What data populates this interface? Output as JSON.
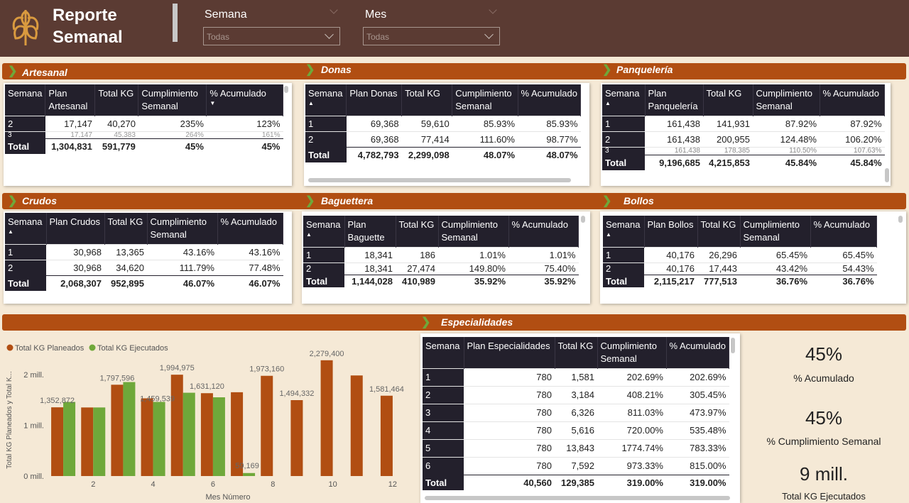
{
  "header": {
    "title_line1": "Reporte",
    "title_line2": "Semanal",
    "slicers": [
      {
        "label": "Semana",
        "value": "Todas"
      },
      {
        "label": "Mes",
        "value": "Todas"
      }
    ]
  },
  "colors": {
    "header_bg": "#5b3b33",
    "section_bar": "#b14e12",
    "table_header": "#23202c",
    "planned": "#b14e12",
    "executed": "#6fa83a",
    "page_bg": "#f5e9d6"
  },
  "sections": {
    "artesanal": {
      "title": "Artesanal",
      "headers": [
        "Semana",
        "Plan Artesanal",
        "Total KG",
        "Cumplimiento Semanal",
        "% Acumulado"
      ],
      "rows": [
        [
          "2",
          "17,147",
          "40,270",
          "235%",
          "123%"
        ],
        [
          "3",
          "17,147",
          "45,383",
          "264%",
          "161%"
        ]
      ],
      "total": [
        "Total",
        "1,304,831",
        "591,779",
        "45%",
        "45%"
      ]
    },
    "donas": {
      "title": "Donas",
      "headers": [
        "Semana",
        "Plan Donas",
        "Total KG",
        "Cumplimiento Semanal",
        "% Acumulado"
      ],
      "rows": [
        [
          "1",
          "69,368",
          "59,610",
          "85.93%",
          "85.93%"
        ],
        [
          "2",
          "69,368",
          "77,414",
          "111.60%",
          "98.77%"
        ]
      ],
      "total": [
        "Total",
        "4,782,793",
        "2,299,098",
        "48.07%",
        "48.07%"
      ]
    },
    "panqueleria": {
      "title": "Panquelería",
      "headers": [
        "Semana",
        "Plan Panquelería",
        "Total KG",
        "Cumplimiento Semanal",
        "% Acumulado"
      ],
      "rows": [
        [
          "1",
          "161,438",
          "141,931",
          "87.92%",
          "87.92%"
        ],
        [
          "2",
          "161,438",
          "200,955",
          "124.48%",
          "106.20%"
        ],
        [
          "3",
          "161,438",
          "178,385",
          "110.50%",
          "107.63%"
        ]
      ],
      "total": [
        "Total",
        "9,196,685",
        "4,215,853",
        "45.84%",
        "45.84%"
      ]
    },
    "crudos": {
      "title": "Crudos",
      "headers": [
        "Semana",
        "Plan Crudos",
        "Total KG",
        "Cumplimiento Semanal",
        "% Acumulado"
      ],
      "rows": [
        [
          "1",
          "30,968",
          "13,365",
          "43.16%",
          "43.16%"
        ],
        [
          "2",
          "30,968",
          "34,620",
          "111.79%",
          "77.48%"
        ]
      ],
      "total": [
        "Total",
        "2,068,307",
        "952,895",
        "46.07%",
        "46.07%"
      ]
    },
    "baguettera": {
      "title": "Baguettera",
      "headers": [
        "Semana",
        "Plan Baguette",
        "Total KG",
        "Cumplimiento Semanal",
        "% Acumulado"
      ],
      "rows": [
        [
          "1",
          "18,341",
          "186",
          "1.01%",
          "1.01%"
        ],
        [
          "2",
          "18,341",
          "27,474",
          "149.80%",
          "75.40%"
        ]
      ],
      "total": [
        "Total",
        "1,144,028",
        "410,989",
        "35.92%",
        "35.92%"
      ]
    },
    "bollos": {
      "title": "Bollos",
      "headers": [
        "Semana",
        "Plan Bollos",
        "Total KG",
        "Cumplimiento Semanal",
        "% Acumulado"
      ],
      "rows": [
        [
          "1",
          "40,176",
          "26,296",
          "65.45%",
          "65.45%"
        ],
        [
          "2",
          "40,176",
          "17,443",
          "43.42%",
          "54.43%"
        ]
      ],
      "total": [
        "Total",
        "2,115,217",
        "777,513",
        "36.76%",
        "36.76%"
      ]
    },
    "especialidades": {
      "title": "Especialidades",
      "headers": [
        "Semana",
        "Plan Especialidades",
        "Total KG",
        "Cumplimiento Semanal",
        "% Acumulado"
      ],
      "rows": [
        [
          "1",
          "780",
          "1,581",
          "202.69%",
          "202.69%"
        ],
        [
          "2",
          "780",
          "3,184",
          "408.21%",
          "305.45%"
        ],
        [
          "3",
          "780",
          "6,326",
          "811.03%",
          "473.97%"
        ],
        [
          "4",
          "780",
          "5,616",
          "720.00%",
          "535.48%"
        ],
        [
          "5",
          "780",
          "13,843",
          "1774.74%",
          "783.33%"
        ],
        [
          "6",
          "780",
          "7,592",
          "973.33%",
          "815.00%"
        ]
      ],
      "total": [
        "Total",
        "40,560",
        "129,385",
        "319.00%",
        "319.00%"
      ]
    }
  },
  "kpis": [
    {
      "value": "45%",
      "label": "% Acumulado"
    },
    {
      "value": "45%",
      "label": "% Cumplimiento Semanal"
    },
    {
      "value": "9 mill.",
      "label": "Total KG Ejecutados"
    }
  ],
  "chart_data": {
    "type": "bar",
    "legend": [
      "Total KG Planeados",
      "Total KG Ejecutados"
    ],
    "legend_position": "top-left",
    "xlabel": "Mes Número",
    "ylabel": "Total KG Planeados y Total K...",
    "x": [
      1,
      2,
      3,
      4,
      5,
      6,
      7,
      8,
      9,
      10,
      11,
      12
    ],
    "x_ticks": [
      "2",
      "4",
      "6",
      "8",
      "10",
      "12"
    ],
    "y_ticks": [
      "0 mill.",
      "1 mill.",
      "2 mill."
    ],
    "ylim": [
      0,
      2500000
    ],
    "series": [
      {
        "name": "Total KG Planeados",
        "values": [
          1352872,
          1350000,
          1797596,
          1530000,
          1994975,
          1631120,
          1650000,
          1973160,
          1494332,
          2279400,
          1980000,
          1581464
        ]
      },
      {
        "name": "Total KG Ejecutados",
        "values": [
          1459000,
          1350000,
          1850000,
          1459539,
          1640000,
          1550000,
          59169,
          null,
          null,
          null,
          null,
          null
        ]
      }
    ],
    "data_labels": [
      {
        "x": 1,
        "text": "1,352,872"
      },
      {
        "x": 3,
        "text": "1,797,596"
      },
      {
        "x": 4,
        "text": "1,459,539"
      },
      {
        "x": 5,
        "text": "1,994,975"
      },
      {
        "x": 6,
        "text": "1,631,120"
      },
      {
        "x": 7,
        "text": "59,169"
      },
      {
        "x": 8,
        "text": "1,973,160"
      },
      {
        "x": 9,
        "text": "1,494,332"
      },
      {
        "x": 10,
        "text": "2,279,400"
      },
      {
        "x": 12,
        "text": "1,581,464"
      }
    ]
  }
}
